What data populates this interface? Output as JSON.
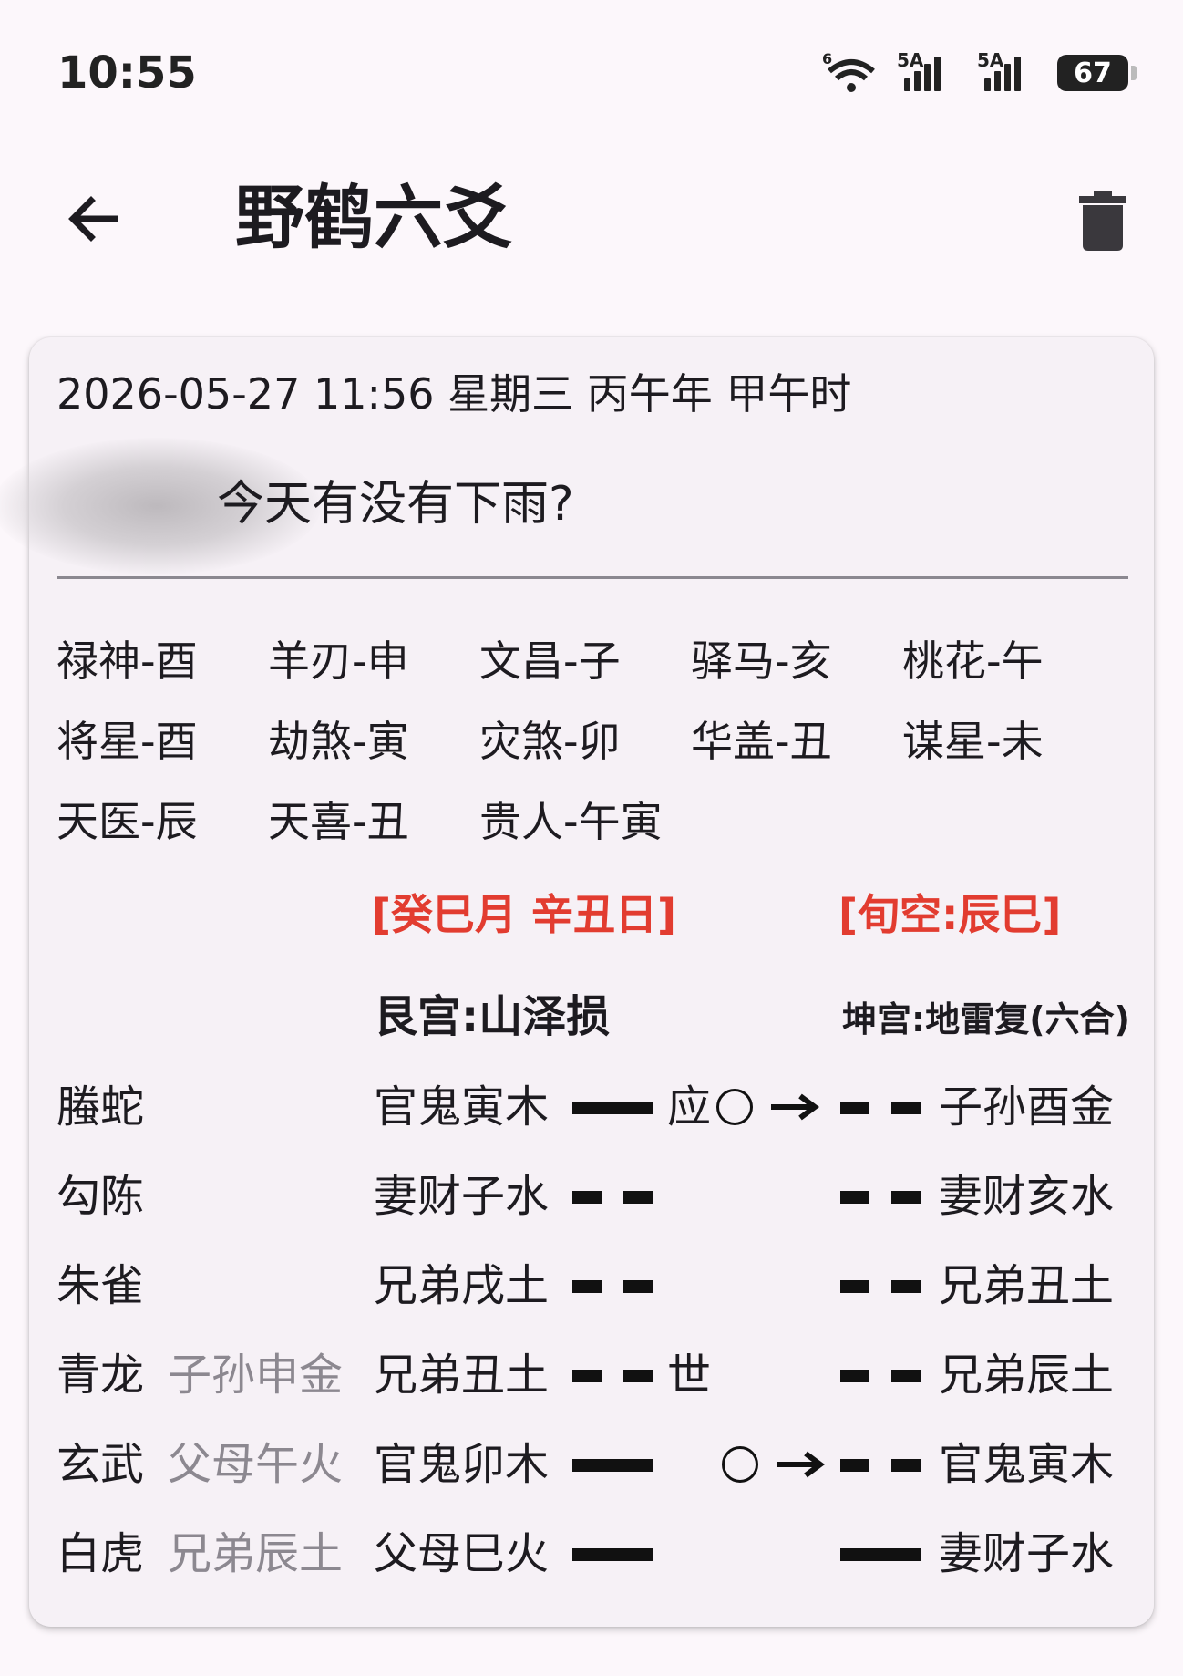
{
  "status_bar": {
    "time": "10:55",
    "wifi_label": "6",
    "sim1_label": "5A",
    "sim2_label": "5A",
    "battery": "67"
  },
  "app_bar": {
    "title": "野鹤六爻",
    "back_icon": "arrow-left-icon",
    "delete_icon": "trash-icon"
  },
  "card": {
    "datetime": "2026-05-27 11:56  星期三  丙午年 甲午时",
    "question": "今天有没有下雨?",
    "shensha": [
      [
        "禄神-酉",
        "羊刃-申",
        "文昌-子",
        "驿马-亥",
        "桃花-午"
      ],
      [
        "将星-酉",
        "劫煞-寅",
        "灾煞-卯",
        "华盖-丑",
        "谋星-未"
      ],
      [
        "天医-辰",
        "天喜-丑",
        "贵人-午寅"
      ]
    ],
    "month_day": "[癸巳月  辛丑日]",
    "xunkong": "[旬空:辰巳]",
    "main_gua": "艮宫:山泽损",
    "bian_gua": "坤宫:地雷复(六合)",
    "yao_rows": [
      {
        "god": "螣蛇",
        "fushen": "",
        "main": "官鬼寅木",
        "main_line": "yang",
        "mark": "应",
        "moving": true,
        "bian_line": "yin",
        "bian": "子孙酉金"
      },
      {
        "god": "勾陈",
        "fushen": "",
        "main": "妻财子水",
        "main_line": "yin",
        "mark": "",
        "moving": false,
        "bian_line": "yin",
        "bian": "妻财亥水"
      },
      {
        "god": "朱雀",
        "fushen": "",
        "main": "兄弟戌土",
        "main_line": "yin",
        "mark": "",
        "moving": false,
        "bian_line": "yin",
        "bian": "兄弟丑土"
      },
      {
        "god": "青龙",
        "fushen": "子孙申金",
        "main": "兄弟丑土",
        "main_line": "yin",
        "mark": "世",
        "moving": false,
        "bian_line": "yin",
        "bian": "兄弟辰土"
      },
      {
        "god": "玄武",
        "fushen": "父母午火",
        "main": "官鬼卯木",
        "main_line": "yang",
        "mark": "",
        "moving": true,
        "bian_line": "yin",
        "bian": "官鬼寅木"
      },
      {
        "god": "白虎",
        "fushen": "兄弟辰土",
        "main": "父母巳火",
        "main_line": "yang",
        "mark": "",
        "moving": false,
        "bian_line": "yang",
        "bian": "妻财子水"
      }
    ]
  },
  "colors": {
    "background": "#fcf7fb",
    "card": "#f6f1f6",
    "accent_red": "#e23c30",
    "fushen_gray": "#8c8890"
  }
}
